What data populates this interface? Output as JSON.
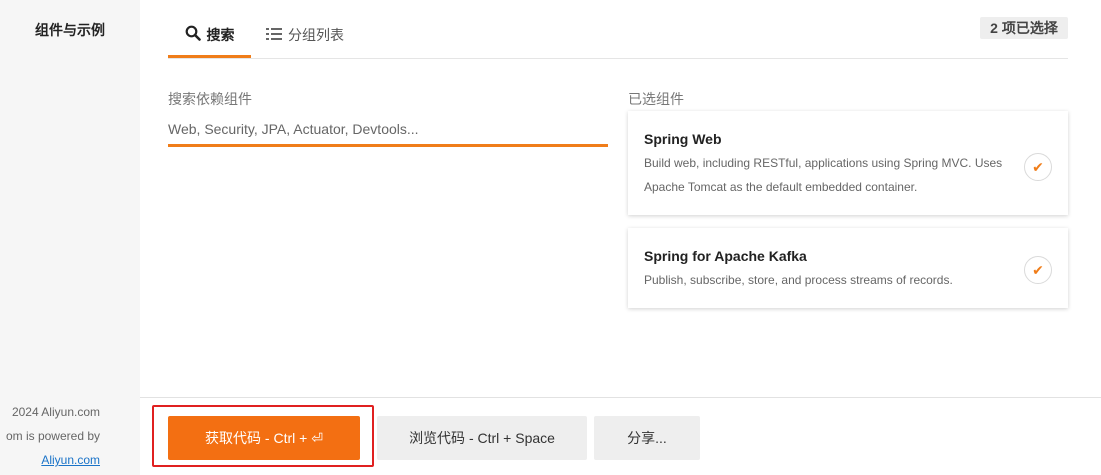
{
  "sidebar": {
    "title": "组件与示例",
    "footer": {
      "line1": "2024 Aliyun.com",
      "line2": "om is powered by",
      "line3": "Aliyun.com"
    }
  },
  "tabs": [
    {
      "label": "搜索",
      "icon": "search-icon",
      "active": true
    },
    {
      "label": "分组列表",
      "icon": "list-icon",
      "active": false
    }
  ],
  "selection_count": "2 项已选择",
  "search": {
    "label": "搜索依赖组件",
    "placeholder": "Web, Security, JPA, Actuator, Devtools...",
    "value": ""
  },
  "selected": {
    "label": "已选组件",
    "items": [
      {
        "title": "Spring Web",
        "description": "Build web, including RESTful, applications using Spring MVC. Uses Apache Tomcat as the default embedded container.",
        "checked": true
      },
      {
        "title": "Spring for Apache Kafka",
        "description": "Publish, subscribe, store, and process streams of records.",
        "checked": true
      }
    ]
  },
  "actions": {
    "get_code": "获取代码 - Ctrl + ⏎",
    "browse_code": "浏览代码 - Ctrl + Space",
    "share": "分享..."
  },
  "colors": {
    "accent": "#f07d19",
    "primary_button": "#f36f12",
    "highlight_border": "#e02020"
  }
}
